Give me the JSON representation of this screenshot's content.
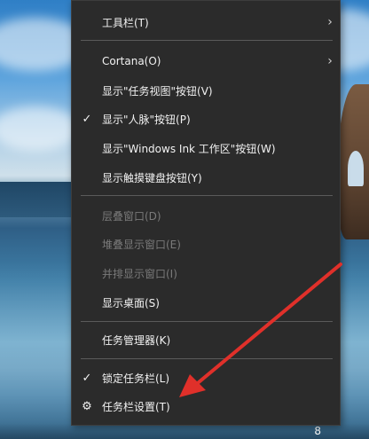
{
  "menu": {
    "items": [
      {
        "label": "工具栏(T)",
        "check": "",
        "submenu": true,
        "disabled": false
      },
      {
        "label": "Cortana(O)",
        "check": "",
        "submenu": true,
        "disabled": false
      },
      {
        "label": "显示\"任务视图\"按钮(V)",
        "check": "",
        "submenu": false,
        "disabled": false
      },
      {
        "label": "显示\"人脉\"按钮(P)",
        "check": "✓",
        "submenu": false,
        "disabled": false
      },
      {
        "label": "显示\"Windows Ink 工作区\"按钮(W)",
        "check": "",
        "submenu": false,
        "disabled": false
      },
      {
        "label": "显示触摸键盘按钮(Y)",
        "check": "",
        "submenu": false,
        "disabled": false
      },
      {
        "label": "层叠窗口(D)",
        "check": "",
        "submenu": false,
        "disabled": true
      },
      {
        "label": "堆叠显示窗口(E)",
        "check": "",
        "submenu": false,
        "disabled": true
      },
      {
        "label": "并排显示窗口(I)",
        "check": "",
        "submenu": false,
        "disabled": true
      },
      {
        "label": "显示桌面(S)",
        "check": "",
        "submenu": false,
        "disabled": false
      },
      {
        "label": "任务管理器(K)",
        "check": "",
        "submenu": false,
        "disabled": false
      },
      {
        "label": "锁定任务栏(L)",
        "check": "✓",
        "submenu": false,
        "disabled": false
      },
      {
        "label": "任务栏设置(T)",
        "check": "⚙",
        "submenu": false,
        "disabled": false
      }
    ],
    "submenu_glyph": "›"
  },
  "colors": {
    "menu_bg": "#2b2b2b",
    "text": "#f2f2f2",
    "disabled_text": "#7a7a7a",
    "separator": "#5a5a5a",
    "arrow": "#e0302a"
  },
  "tray": {
    "glyph": "8"
  }
}
